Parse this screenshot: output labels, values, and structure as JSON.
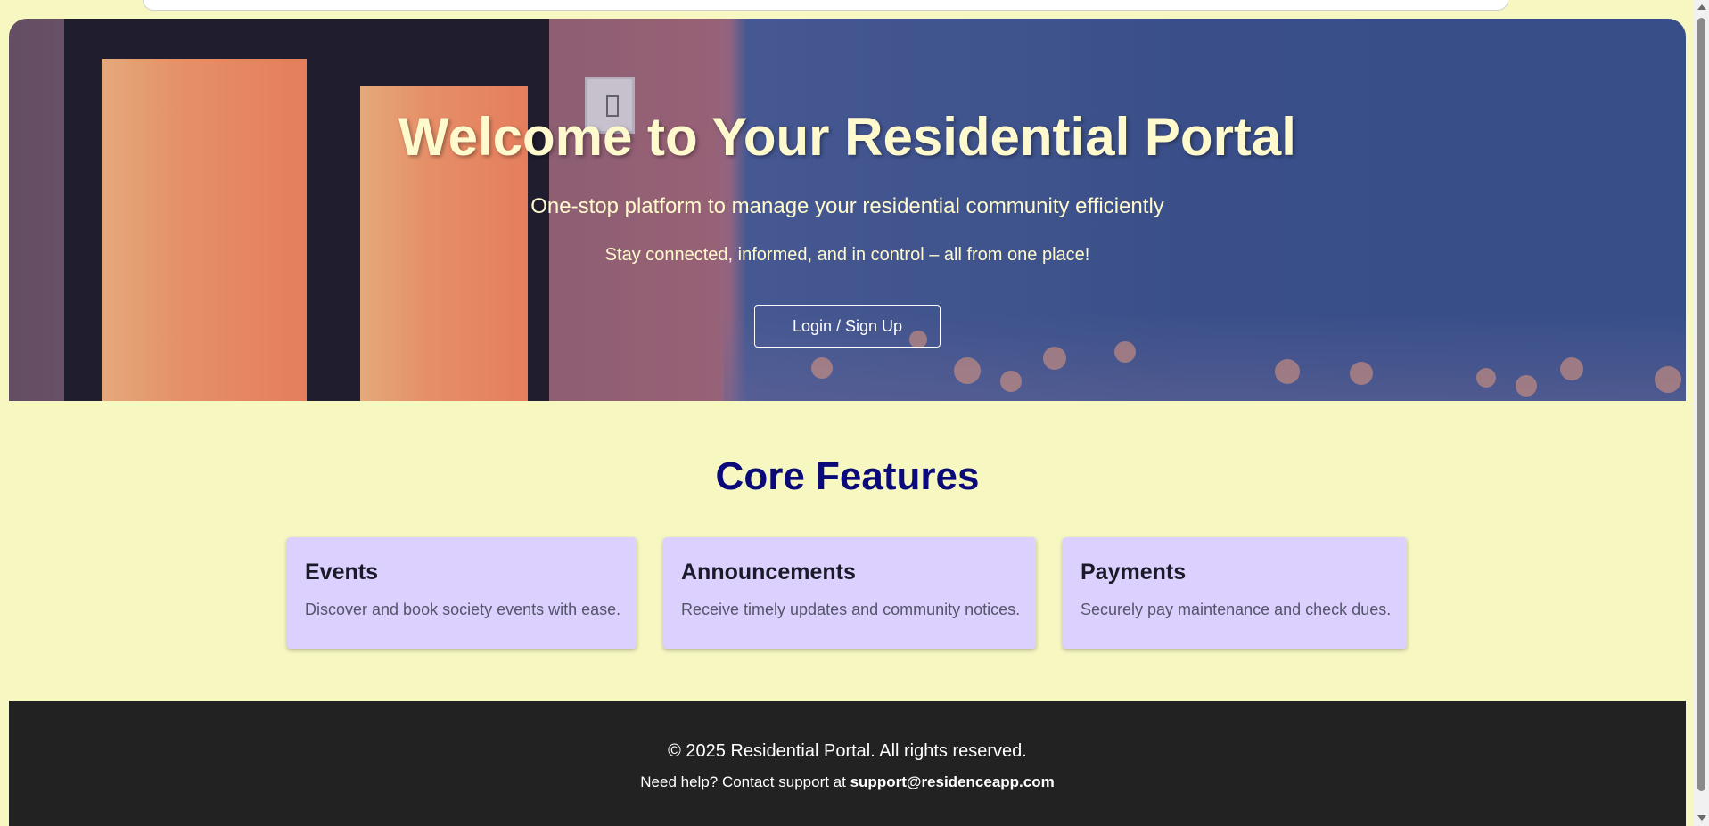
{
  "hero": {
    "title": "Welcome to Your Residential Portal",
    "subtitle": "One-stop platform to manage your residential community efficiently",
    "tagline": "Stay connected, informed, and in control – all from one place!",
    "cta_label": "Login / Sign Up"
  },
  "features": {
    "heading": "Core Features",
    "cards": [
      {
        "title": "Events",
        "description": "Discover and book society events with ease."
      },
      {
        "title": "Announcements",
        "description": "Receive timely updates and community notices."
      },
      {
        "title": "Payments",
        "description": "Securely pay maintenance and check dues."
      }
    ]
  },
  "footer": {
    "copyright": "© 2025 Residential Portal. All rights reserved.",
    "help_prefix": "Need help? Contact support at ",
    "support_email": "support@residenceapp.com"
  },
  "colors": {
    "page_background": "#f7f7c1",
    "hero_text": "#fffacd",
    "features_heading": "#0a0a7a",
    "card_background": "#dcd0ff",
    "footer_background": "#222222"
  }
}
